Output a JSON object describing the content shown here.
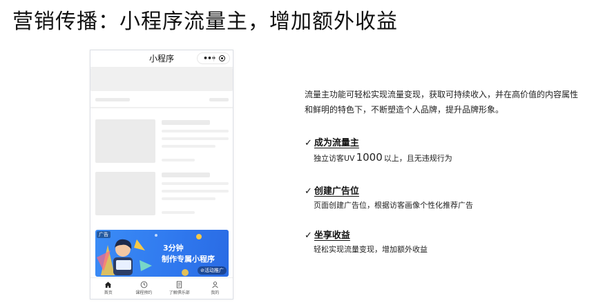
{
  "slide": {
    "title": "营销传播：小程序流量主，增加额外收益"
  },
  "phone": {
    "nav_title": "小程序",
    "capsule_more": "•••",
    "banner": {
      "tag": "广告",
      "line1": "3分钟",
      "line2": "制作专属小程序",
      "button": "⊘活动推广"
    },
    "tabs": [
      {
        "label": "首页",
        "icon": "home-icon"
      },
      {
        "label": "课程预约",
        "icon": "clock-icon"
      },
      {
        "label": "了解俱乐部",
        "icon": "document-icon"
      },
      {
        "label": "我的",
        "icon": "user-icon"
      }
    ]
  },
  "content": {
    "description": "流量主功能可轻松实现流量变现，获取可持续收入，并在高价值的内容属性和鲜明的特色下，不断塑造个人品牌，提升品牌形象。",
    "features": [
      {
        "check": "✓",
        "title": "成为流量主",
        "sub_prefix": "独立访客UV",
        "sub_number": "1000",
        "sub_suffix": "以上，且无违规行为"
      },
      {
        "check": "✓",
        "title": "创建广告位",
        "sub": "页面创建广告位，根据访客画像个性化推荐广告"
      },
      {
        "check": "✓",
        "title": "坐享收益",
        "sub": "轻松实现流量变现，增加额外收益"
      }
    ]
  }
}
